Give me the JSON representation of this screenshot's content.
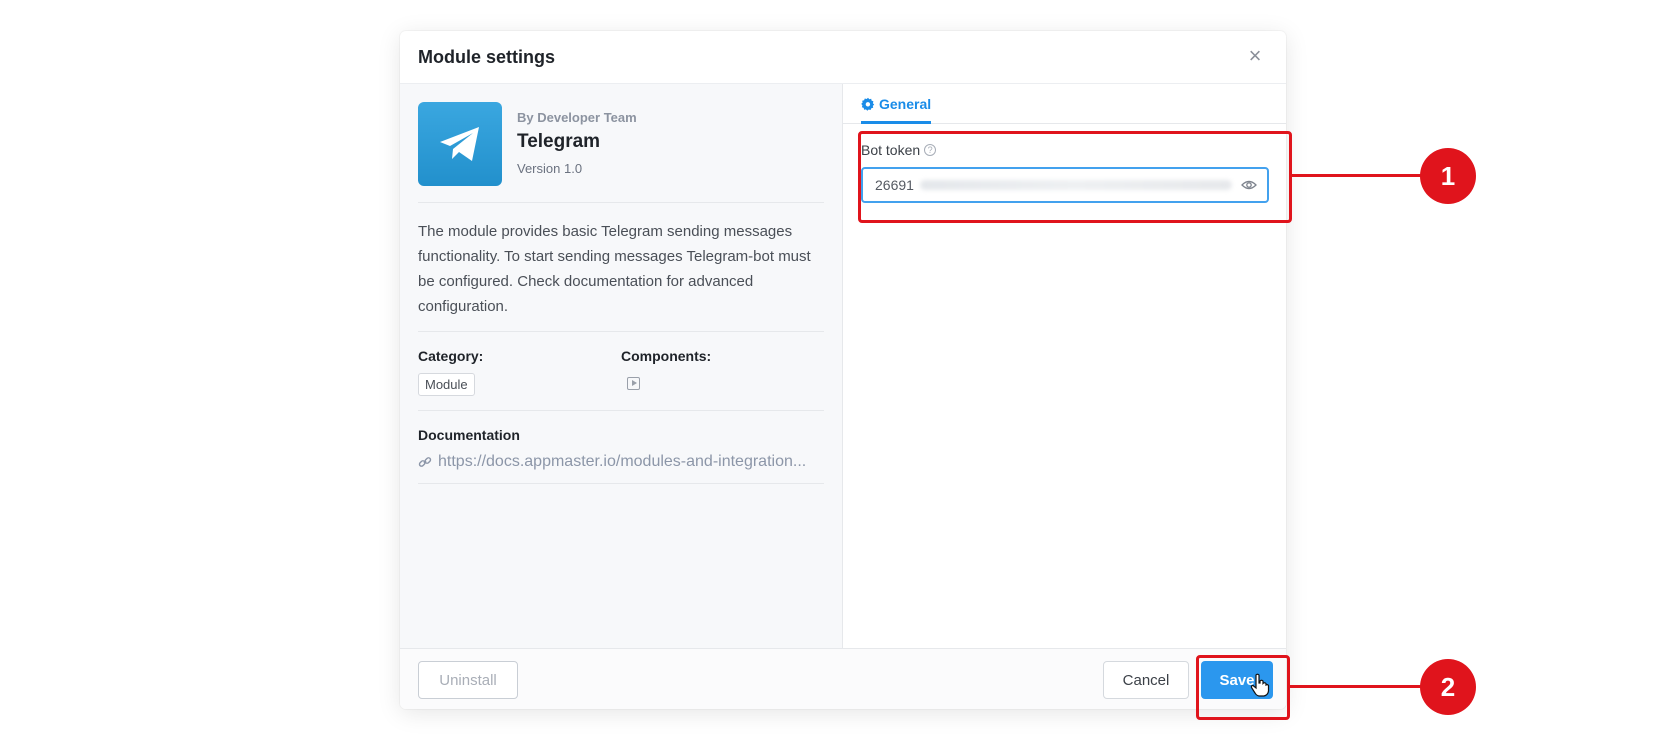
{
  "modal": {
    "title": "Module settings",
    "close_icon": "close-icon"
  },
  "module": {
    "by": "By Developer Team",
    "name": "Telegram",
    "version": "Version 1.0",
    "description": "The module provides basic Telegram sending messages functionality. To start sending messages Telegram-bot must be configured. Check documentation for advanced configuration.",
    "category_label": "Category:",
    "category_value": "Module",
    "components_label": "Components:",
    "documentation_label": "Documentation",
    "documentation_link": "https://docs.appmaster.io/modules-and-integration..."
  },
  "tabs": [
    {
      "label": "General",
      "icon": "gear-icon",
      "active": true
    }
  ],
  "bot_token": {
    "label": "Bot token",
    "value": "26691"
  },
  "footer": {
    "uninstall_label": "Uninstall",
    "cancel_label": "Cancel",
    "save_label": "Save"
  },
  "annotations": [
    {
      "number": "1"
    },
    {
      "number": "2"
    }
  ],
  "colors": {
    "accent": "#2b97ee",
    "highlight": "#e0141c",
    "telegram": "#2a9ad8"
  }
}
